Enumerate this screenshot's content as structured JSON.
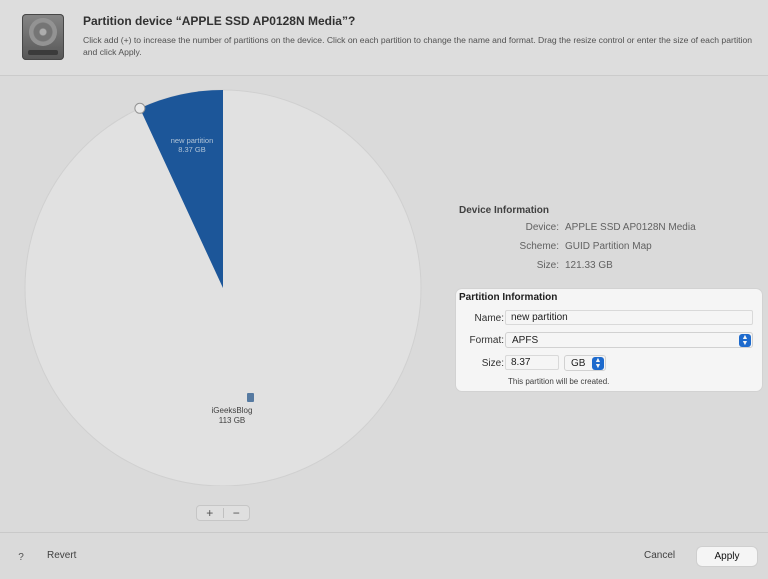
{
  "header": {
    "title": "Partition device “APPLE SSD AP0128N Media”?",
    "description": "Click add (+) to increase the number of partitions on the device. Click on each partition to change the name and format. Drag the resize control or enter the size of each partition and click Apply.",
    "icon": "internal-disk-icon"
  },
  "pie": {
    "slices": [
      {
        "name": "new partition",
        "size": "8.37 GB",
        "size_gb": 8.37,
        "color": "#1e5aa0"
      },
      {
        "name": "iGeeksBlog",
        "size": "113 GB",
        "size_gb": 113,
        "color": "#ebebeb"
      }
    ],
    "add_label": "+",
    "remove_label": "−"
  },
  "device_info": {
    "title": "Device Information",
    "rows": [
      {
        "label": "Device:",
        "value": "APPLE SSD AP0128N Media"
      },
      {
        "label": "Scheme:",
        "value": "GUID Partition Map"
      },
      {
        "label": "Size:",
        "value": "121.33 GB"
      }
    ]
  },
  "partition_info": {
    "title": "Partition Information",
    "name_label": "Name:",
    "name_value": "new partition",
    "format_label": "Format:",
    "format_value": "APFS",
    "size_label": "Size:",
    "size_value": "8.37",
    "unit_value": "GB",
    "note": "This partition will be created."
  },
  "footer": {
    "help_label": "?",
    "revert_label": "Revert",
    "cancel_label": "Cancel",
    "apply_label": "Apply"
  },
  "colors": {
    "accent": "#1f6fd6",
    "partition_fill": "#1e5aa0"
  }
}
